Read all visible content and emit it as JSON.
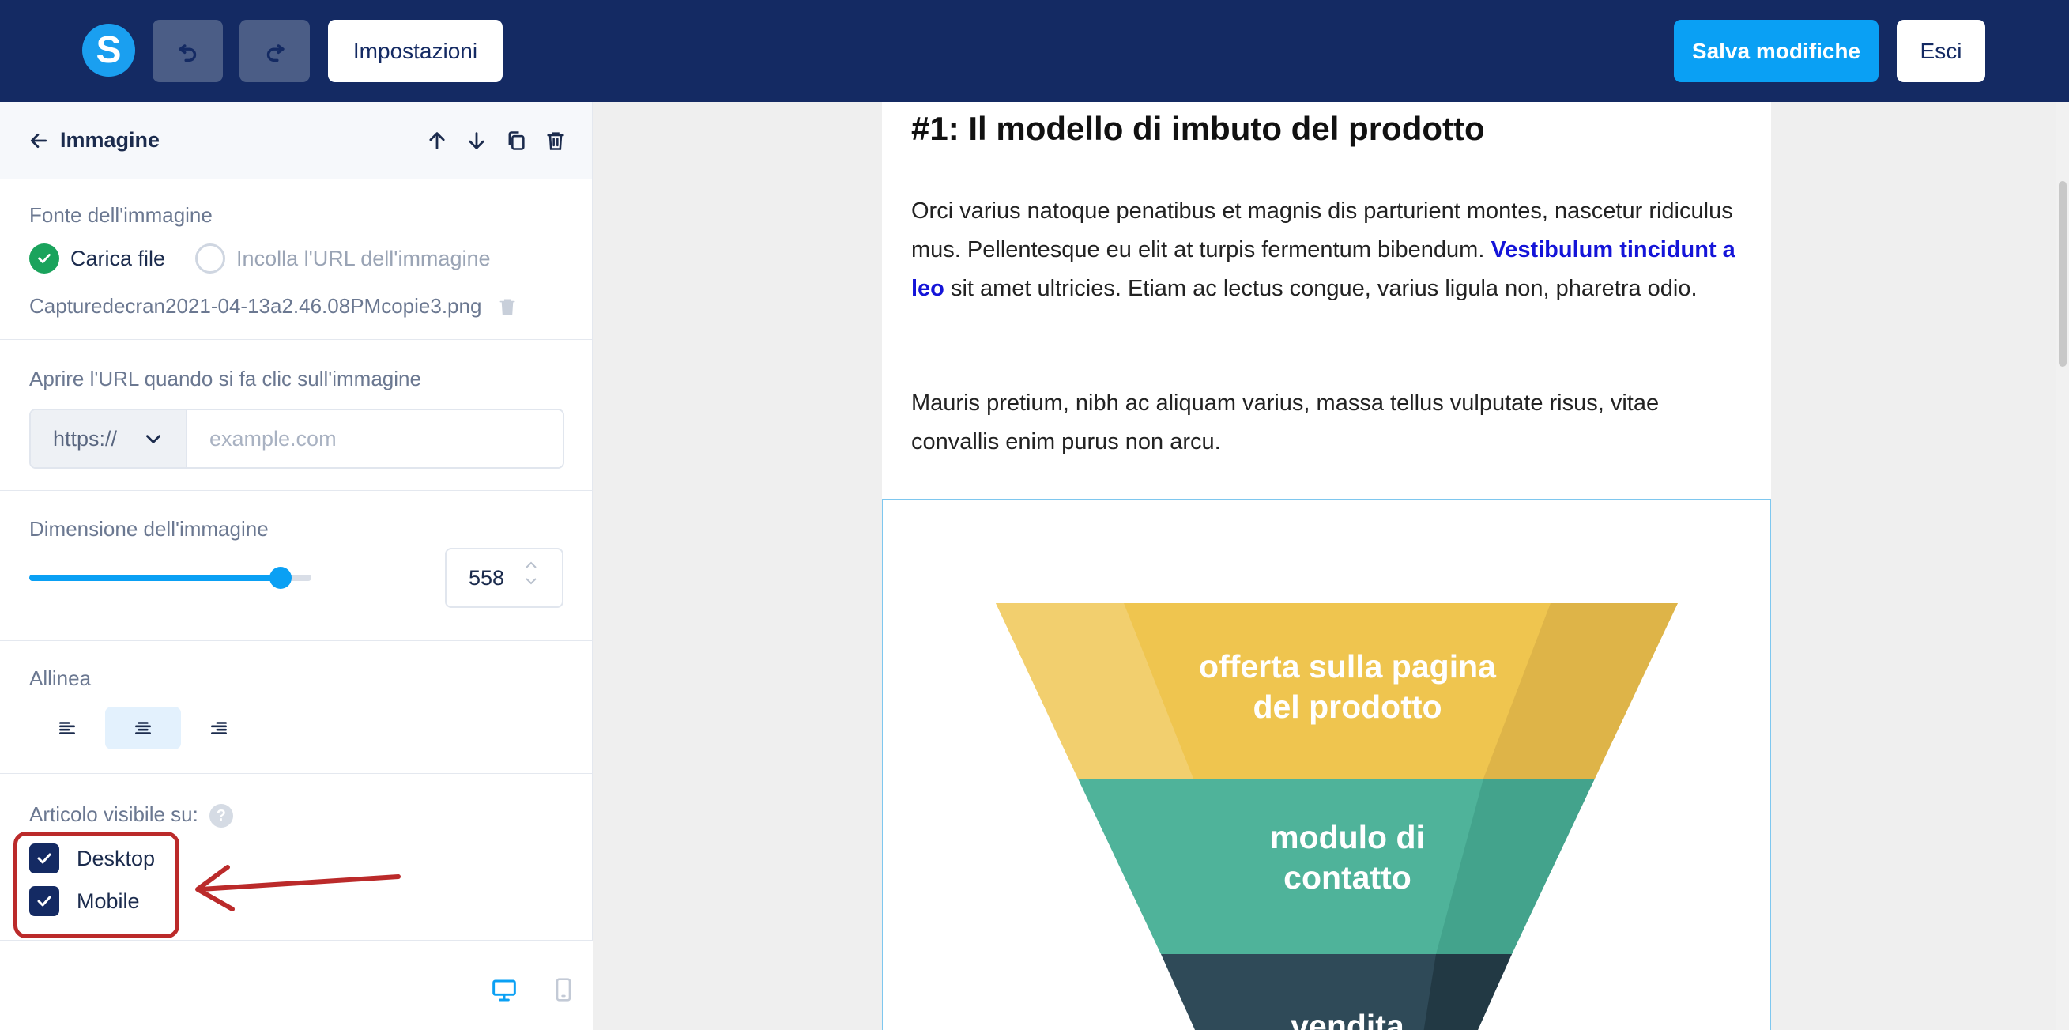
{
  "topbar": {
    "logo_letter": "S",
    "settings_label": "Impostazioni",
    "save_label": "Salva modifiche",
    "exit_label": "Esci"
  },
  "panel": {
    "title": "Immagine",
    "image_source": {
      "label": "Fonte dell'immagine",
      "option_upload": "Carica file",
      "option_url": "Incolla l'URL dell'immagine",
      "selected": "upload",
      "filename": "Capturedecran2021-04-13a2.46.08PMcopie3.png"
    },
    "link": {
      "label": "Aprire l'URL quando si fa clic sull'immagine",
      "protocol": "https://",
      "placeholder": "example.com",
      "value": ""
    },
    "size": {
      "label": "Dimensione dell'immagine",
      "value": "558",
      "slider_fraction": 0.89
    },
    "align": {
      "label": "Allinea",
      "selected": "center"
    },
    "visibility": {
      "label": "Articolo visibile su:",
      "help": "?",
      "desktop_label": "Desktop",
      "mobile_label": "Mobile",
      "desktop_checked": true,
      "mobile_checked": true
    },
    "footer": {
      "active_view": "desktop"
    }
  },
  "email": {
    "heading": "#1: Il modello di imbuto del prodotto",
    "p1_before": "Orci varius natoque penatibus et magnis dis parturient montes, nascetur ridiculus mus. Pellentesque eu elit at turpis fermentum bibendum. ",
    "p1_link": "Vestibulum tincidunt a leo",
    "p1_after": " sit amet ultricies. Etiam ac lectus congue, varius ligula non, pharetra odio.",
    "p2": "Mauris pretium, nibh ac aliquam varius, massa tellus vulputate risus, vitae convallis enim purus non arcu.",
    "funnel": {
      "top_line1": "offerta sulla pagina",
      "top_line2": "del prodotto",
      "mid_line1": "modulo di",
      "mid_line2": "contatto",
      "bottom": "vendita"
    }
  },
  "colors": {
    "topbar": "#142a63",
    "accent": "#0aa0f4",
    "success": "#1aa35c",
    "annotation": "#bb2a2a",
    "funnel_top": "#efc54f",
    "funnel_mid": "#4fb39a",
    "funnel_bottom": "#2f4a58"
  }
}
